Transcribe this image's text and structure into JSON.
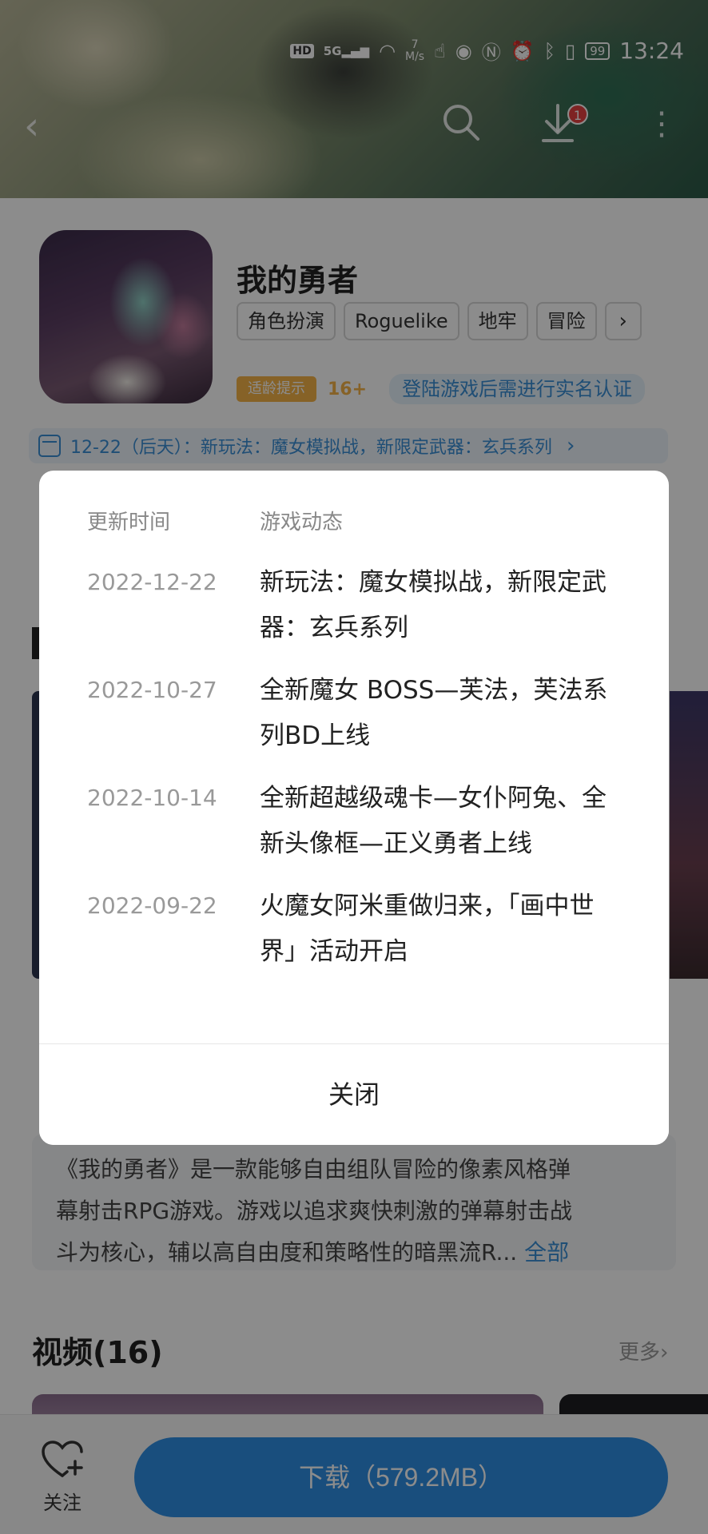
{
  "status_bar": {
    "hd": "HD",
    "network": "5G",
    "speed_value": "7",
    "speed_unit": "M/s",
    "battery": "99",
    "time": "13:24"
  },
  "nav": {
    "download_badge": "1"
  },
  "app": {
    "name": "我的勇者",
    "tags": [
      "角色扮演",
      "Roguelike",
      "地牢",
      "冒险"
    ],
    "age_tip_label": "适龄提示",
    "age_rating": "16+",
    "verify_note": "登陆游戏后需进行实名认证",
    "update_strip": "12-22（后天）：新玩法：魔女模拟战，新限定武器：玄兵系列"
  },
  "description": {
    "line1": "《我的勇者》是一款能够自由组队冒险的像素风格弹",
    "line2": "幕射击RPG游戏。游戏以追求爽快刺激的弹幕射击战",
    "line3": "斗为核心，辅以高自由度和策略性的暗黑流R...",
    "more": "全部"
  },
  "video_section": {
    "title": "视频(16)",
    "more": "更多›"
  },
  "bottom_bar": {
    "follow_label": "关注",
    "download_label": "下载（579.2MB）"
  },
  "dialog": {
    "header_date": "更新时间",
    "header_news": "游戏动态",
    "rows": [
      {
        "date": "2022-12-22",
        "text": "新玩法：魔女模拟战，新限定武器：玄兵系列"
      },
      {
        "date": "2022-10-27",
        "text": "全新魔女 BOSS—芙法，芙法系列BD上线"
      },
      {
        "date": "2022-10-14",
        "text": "全新超越级魂卡—女仆阿兔、全新头像框—正义勇者上线"
      },
      {
        "date": "2022-09-22",
        "text": "火魔女阿米重做归来，「画中世界」活动开启"
      }
    ],
    "close_label": "关闭"
  }
}
